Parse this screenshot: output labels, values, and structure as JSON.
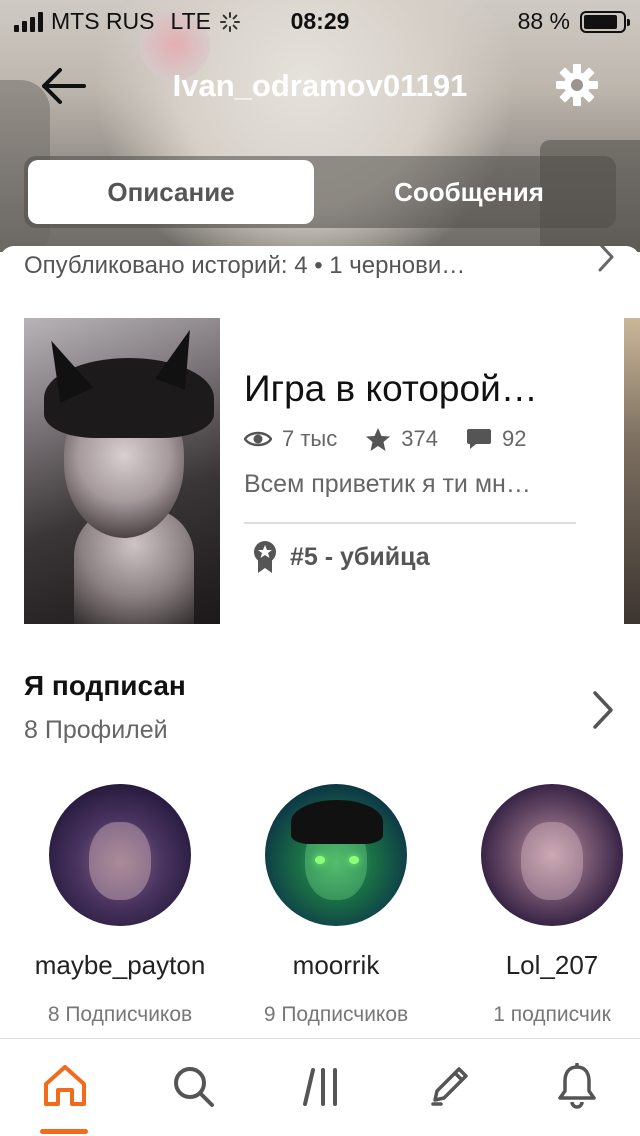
{
  "status_bar": {
    "carrier": "MTS RUS",
    "network": "LTE",
    "time": "08:29",
    "battery": "88 %",
    "battery_level": 0.88
  },
  "header": {
    "username": "Ivan_odramov01191"
  },
  "tabs": {
    "active": "Описание",
    "inactive": "Сообщения"
  },
  "published": {
    "text": "Опубликовано историй: 4 • 1 чернови…"
  },
  "story": {
    "title": "Игра в которой…",
    "views": "7 тыс",
    "stars": "374",
    "comments": "92",
    "description": "Всем приветик я ти мн…",
    "rank": "#5 - убийца"
  },
  "following": {
    "title": "Я подписан",
    "count": "8 Профилей",
    "profiles": [
      {
        "name": "maybe_payton",
        "followers": "8 Подписчиков"
      },
      {
        "name": "moorrik",
        "followers": "9 Подписчиков"
      },
      {
        "name": "Lol_207",
        "followers": "1 подписчик"
      }
    ]
  },
  "colors": {
    "accent": "#f26b1d",
    "icon_gray": "#555555"
  },
  "icons": [
    "back-arrow-icon",
    "gear-icon",
    "eye-icon",
    "star-icon",
    "comment-icon",
    "award-icon",
    "chevron-right-icon",
    "home-icon",
    "search-icon",
    "library-icon",
    "pencil-icon",
    "bell-icon"
  ]
}
